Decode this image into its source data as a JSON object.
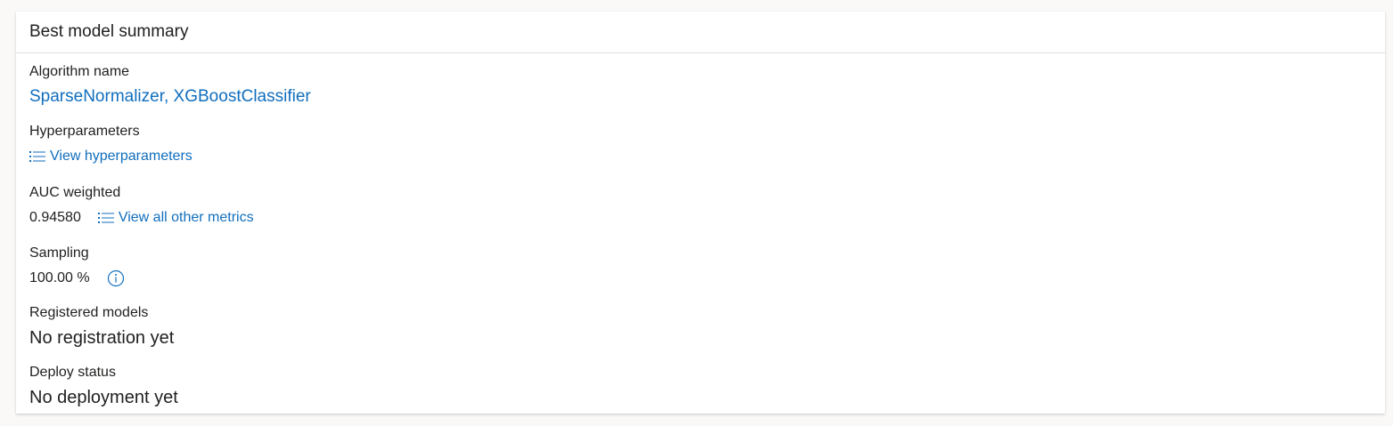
{
  "card": {
    "title": "Best model summary"
  },
  "algorithm": {
    "label": "Algorithm name",
    "value": "SparseNormalizer, XGBoostClassifier"
  },
  "hyperparameters": {
    "label": "Hyperparameters",
    "link_text": "View hyperparameters",
    "icon": "bulleted-list-icon"
  },
  "metric": {
    "label": "AUC weighted",
    "value": "0.94580",
    "link_text": "View all other metrics",
    "icon": "bulleted-list-icon"
  },
  "sampling": {
    "label": "Sampling",
    "value": "100.00 %",
    "icon": "info-icon"
  },
  "registered_models": {
    "label": "Registered models",
    "value": "No registration yet"
  },
  "deploy_status": {
    "label": "Deploy status",
    "value": "No deployment yet"
  },
  "colors": {
    "link": "#106ebe",
    "text": "#201f1e",
    "divider": "#e1dfdd",
    "background": "#faf9f8"
  }
}
